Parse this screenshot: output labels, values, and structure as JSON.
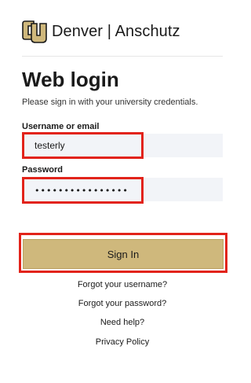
{
  "header": {
    "brand": "Denver | Anschutz",
    "logo_icon": "cu-logo-icon"
  },
  "login": {
    "title": "Web login",
    "subtitle": "Please sign in with your university credentials.",
    "username_label": "Username or email",
    "username_value": "testerly",
    "password_label": "Password",
    "password_value": "••••••••••••••••",
    "sign_in_label": "Sign In"
  },
  "links": {
    "forgot_username": "Forgot your username?",
    "forgot_password": "Forgot your password?",
    "need_help": "Need help?",
    "privacy_policy": "Privacy Policy"
  },
  "colors": {
    "accent_gold": "#cfb87c",
    "highlight_red": "#e2231a",
    "field_bg": "#f2f4f8"
  }
}
